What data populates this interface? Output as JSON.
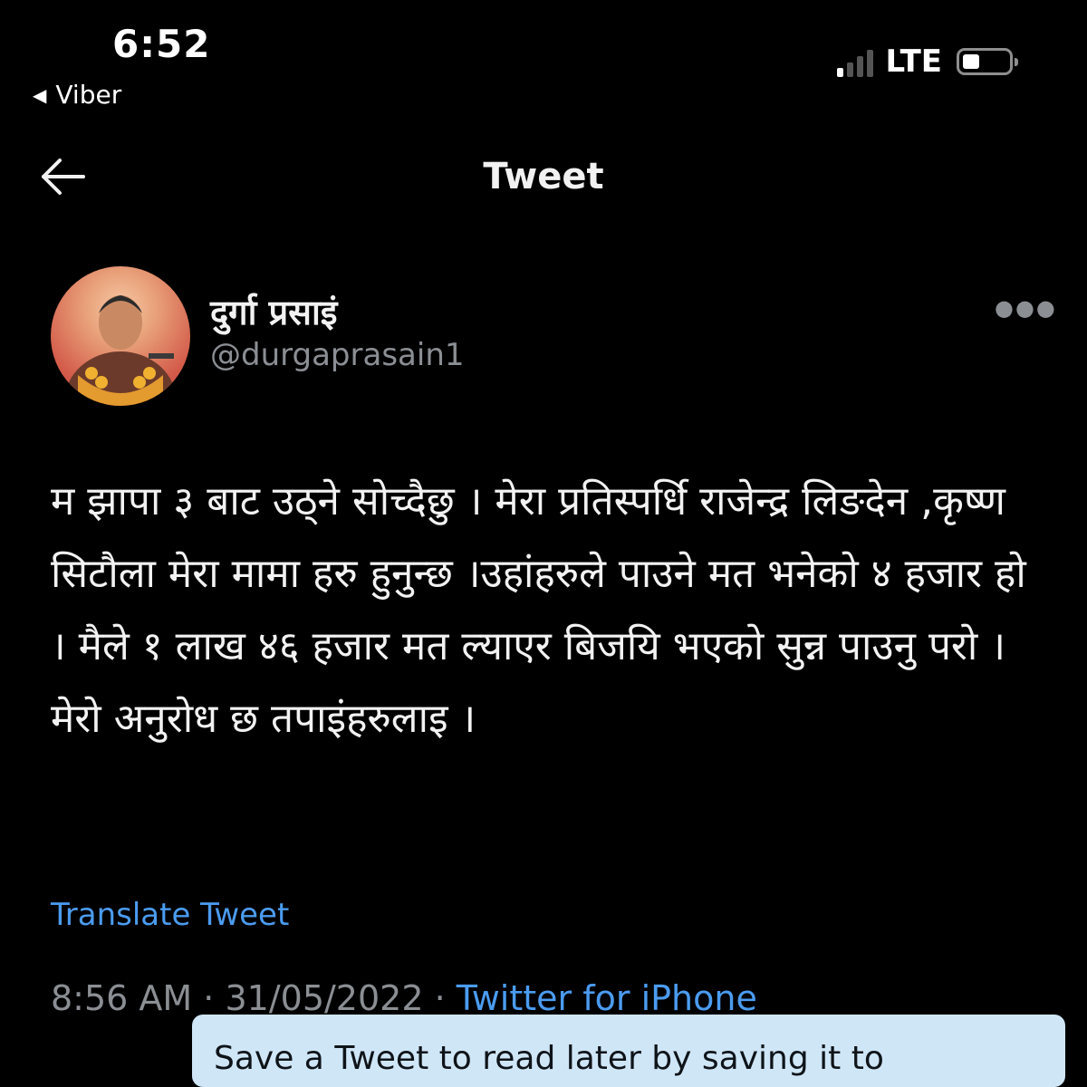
{
  "status_bar": {
    "time": "6:52",
    "back_app": "Viber",
    "network": "LTE"
  },
  "nav": {
    "title": "Tweet"
  },
  "tweet": {
    "author_name": "दुर्गा प्रसाइं",
    "author_handle": "@durgaprasain1",
    "text": "म झापा ३ बाट उठ्ने सोच्दैछु । मेरा प्रतिस्पर्धि राजेन्द्र लिङदेन ,कृष्ण सिटौला मेरा मामा हरु हुनुन्छ ।उहांहरुले पाउने मत भनेको ४ हजार हो । मैले १ लाख ४६ हजार मत ल्याएर बिजयि भएको सुन्न पाउनु परो ।मेरो अनुरोध छ तपाइंहरुलाइ ।",
    "translate_label": "Translate Tweet",
    "time": "8:56 AM",
    "separator": "·",
    "date": "31/05/2022",
    "source": "Twitter for iPhone"
  },
  "toast": {
    "text": "Save a Tweet to read later by saving it to"
  },
  "colors": {
    "background": "#000000",
    "link": "#4b9cf0",
    "secondary_text": "#8b8f94",
    "toast_background": "#cfe6f7"
  },
  "icons": {
    "back": "arrow-left-icon",
    "more": "more-horizontal-icon"
  }
}
